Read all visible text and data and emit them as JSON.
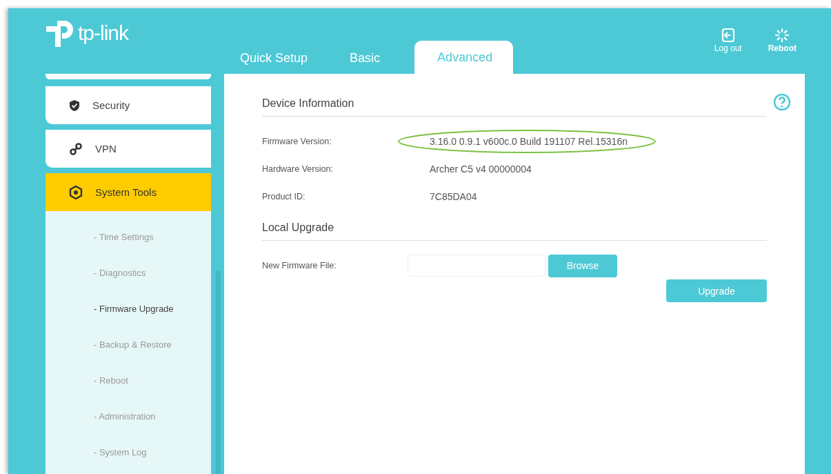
{
  "header": {
    "brand": "tp-link",
    "tabs": [
      {
        "label": "Quick Setup",
        "selected": false
      },
      {
        "label": "Basic",
        "selected": false
      },
      {
        "label": "Advanced",
        "selected": true
      }
    ],
    "actions": [
      {
        "kind": "logout",
        "label": "Log out"
      },
      {
        "kind": "reboot",
        "label": "Reboot"
      }
    ]
  },
  "sidebar": {
    "items": [
      {
        "kind": "shield",
        "label": "Security",
        "selected": false
      },
      {
        "kind": "link",
        "label": "VPN",
        "selected": false
      },
      {
        "kind": "gear",
        "label": "System Tools",
        "selected": true
      }
    ],
    "subitems": [
      {
        "label": "- Time Settings",
        "selected": false
      },
      {
        "label": "- Diagnostics",
        "selected": false
      },
      {
        "label": "- Firmware Upgrade",
        "selected": true
      },
      {
        "label": "- Backup & Restore",
        "selected": false
      },
      {
        "label": "- Reboot",
        "selected": false
      },
      {
        "label": "- Administration",
        "selected": false
      },
      {
        "label": "- System Log",
        "selected": false
      }
    ]
  },
  "device_information": {
    "title": "Device Information",
    "rows": [
      {
        "label": "Firmware Version:",
        "value": "3.16.0 0.9.1 v600c.0 Build 191107 Rel.15316n",
        "highlighted": true
      },
      {
        "label": "Hardware Version:",
        "value": "Archer C5 v4 00000004",
        "highlighted": false
      },
      {
        "label": "Product ID:",
        "value": "7C85DA04",
        "highlighted": false
      }
    ]
  },
  "local_upgrade": {
    "title": "Local Upgrade",
    "file_label": "New Firmware File:",
    "browse_button": "Browse",
    "upgrade_button": "Upgrade"
  }
}
